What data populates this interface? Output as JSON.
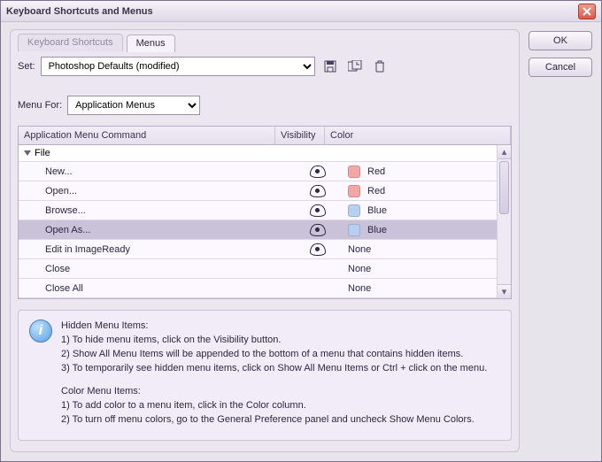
{
  "window": {
    "title": "Keyboard Shortcuts and Menus"
  },
  "buttons": {
    "ok": "OK",
    "cancel": "Cancel"
  },
  "tabs": {
    "shortcuts": "Keyboard Shortcuts",
    "menus": "Menus",
    "active": "menus"
  },
  "set": {
    "label": "Set:",
    "value": "Photoshop Defaults (modified)"
  },
  "menuFor": {
    "label": "Menu For:",
    "value": "Application Menus"
  },
  "grid": {
    "headers": {
      "command": "Application Menu Command",
      "visibility": "Visibility",
      "color": "Color"
    },
    "group": "File",
    "rows": [
      {
        "cmd": "New...",
        "visible": true,
        "colorName": "Red",
        "swatch": "#f3a6a6",
        "selected": false
      },
      {
        "cmd": "Open...",
        "visible": true,
        "colorName": "Red",
        "swatch": "#f3a6a6",
        "selected": false
      },
      {
        "cmd": "Browse...",
        "visible": true,
        "colorName": "Blue",
        "swatch": "#b8cff2",
        "selected": false
      },
      {
        "cmd": "Open As...",
        "visible": true,
        "colorName": "Blue",
        "swatch": "#b8cff2",
        "selected": true
      },
      {
        "cmd": "Edit in ImageReady",
        "visible": true,
        "colorName": "None",
        "swatch": null,
        "selected": false
      },
      {
        "cmd": "Close",
        "visible": false,
        "colorName": "None",
        "swatch": null,
        "selected": false
      },
      {
        "cmd": "Close All",
        "visible": false,
        "colorName": "None",
        "swatch": null,
        "selected": false
      }
    ]
  },
  "info": {
    "h1": "Hidden Menu Items:",
    "l1": "1) To hide menu items, click on the Visibility button.",
    "l2": "2) Show All Menu Items will be appended to the bottom of a menu that contains hidden items.",
    "l3": "3) To temporarily see hidden menu items, click on Show All Menu Items or Ctrl + click on the menu.",
    "h2": "Color Menu Items:",
    "l4": "1) To add color to a menu item, click in the Color column.",
    "l5": "2) To turn off menu colors, go to the General Preference panel and uncheck Show Menu Colors."
  }
}
